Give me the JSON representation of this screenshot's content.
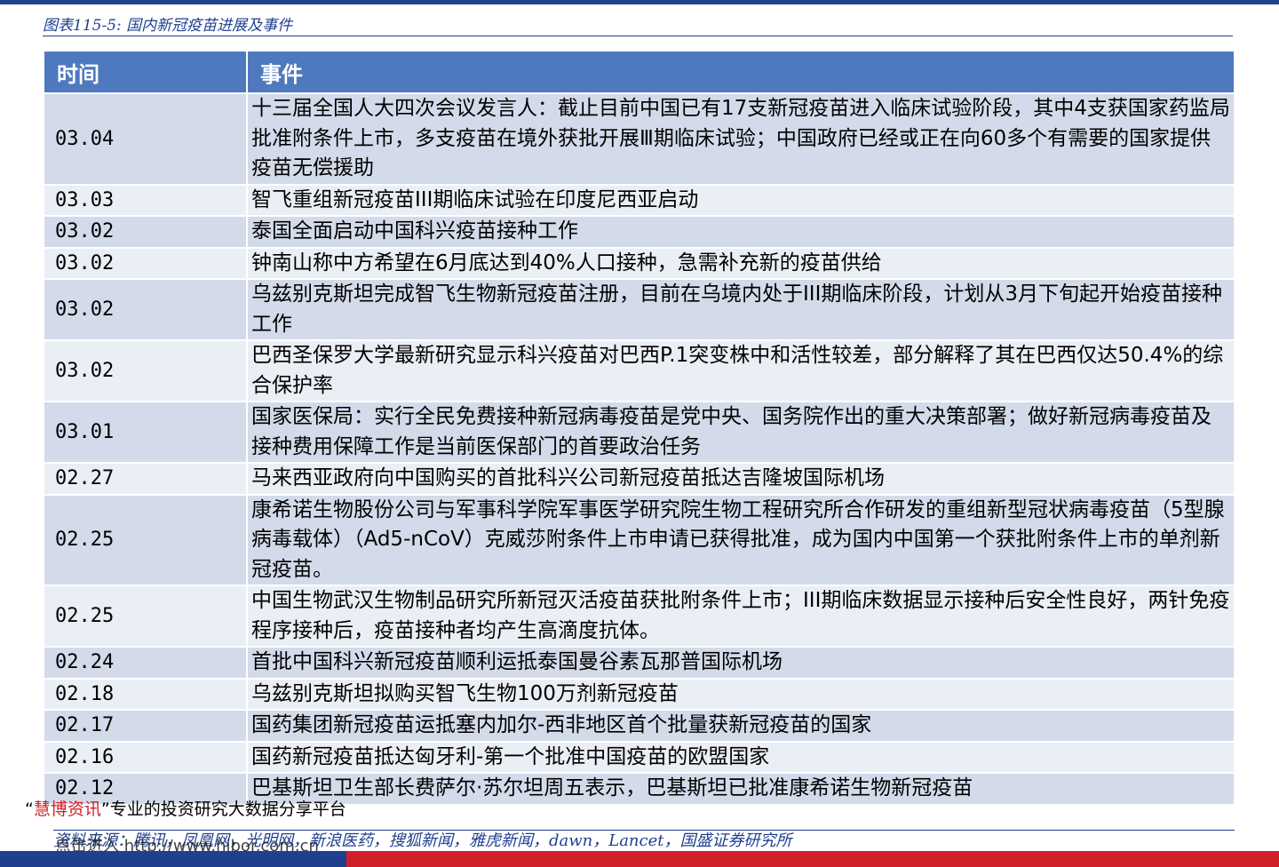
{
  "header": {
    "title": "图表115-5:  国内新冠疫苗进展及事件"
  },
  "table": {
    "columns": [
      "时间",
      "事件"
    ],
    "rows": [
      {
        "date": "03.04",
        "event": "十三届全国人大四次会议发言人：截止目前中国已有17支新冠疫苗进入临床试验阶段，其中4支获国家药监局批准附条件上市，多支疫苗在境外获批开展Ⅲ期临床试验；中国政府已经或正在向60多个有需要的国家提供疫苗无偿援助"
      },
      {
        "date": "03.03",
        "event": "智飞重组新冠疫苗III期临床试验在印度尼西亚启动"
      },
      {
        "date": "03.02",
        "event": "泰国全面启动中国科兴疫苗接种工作"
      },
      {
        "date": "03.02",
        "event": "钟南山称中方希望在6月底达到40%人口接种，急需补充新的疫苗供给"
      },
      {
        "date": "03.02",
        "event": "乌兹别克斯坦完成智飞生物新冠疫苗注册，目前在乌境内处于III期临床阶段，计划从3月下旬起开始疫苗接种工作"
      },
      {
        "date": "03.02",
        "event": "巴西圣保罗大学最新研究显示科兴疫苗对巴西P.1突变株中和活性较差，部分解释了其在巴西仅达50.4%的综合保护率"
      },
      {
        "date": "03.01",
        "event": "国家医保局：实行全民免费接种新冠病毒疫苗是党中央、国务院作出的重大决策部署；做好新冠病毒疫苗及接种费用保障工作是当前医保部门的首要政治任务"
      },
      {
        "date": "02.27",
        "event": "马来西亚政府向中国购买的首批科兴公司新冠疫苗抵达吉隆坡国际机场"
      },
      {
        "date": "02.25",
        "event": "康希诺生物股份公司与军事科学院军事医学研究院生物工程研究所合作研发的重组新型冠状病毒疫苗（5型腺病毒载体）（Ad5-nCoV）克威莎附条件上市申请已获得批准，成为国内中国第一个获批附条件上市的单剂新冠疫苗。"
      },
      {
        "date": "02.25",
        "event": "中国生物武汉生物制品研究所新冠灭活疫苗获批附条件上市；III期临床数据显示接种后安全性良好，两针免疫程序接种后，疫苗接种者均产生高滴度抗体。"
      },
      {
        "date": "02.24",
        "event": "首批中国科兴新冠疫苗顺利运抵泰国曼谷素瓦那普国际机场"
      },
      {
        "date": "02.18",
        "event": "乌兹别克斯坦拟购买智飞生物100万剂新冠疫苗"
      },
      {
        "date": "02.17",
        "event": "国药集团新冠疫苗运抵塞内加尔-西非地区首个批量获新冠疫苗的国家"
      },
      {
        "date": "02.16",
        "event": "国药新冠疫苗抵达匈牙利-第一个批准中国疫苗的欧盟国家"
      },
      {
        "date": "02.12",
        "event": "巴基斯坦卫生部长费萨尔·苏尔坦周五表示，巴基斯坦已批准康希诺生物新冠疫苗"
      }
    ]
  },
  "footer": {
    "brand_open": "“",
    "brand_name": "慧博资讯",
    "brand_close": "”",
    "tagline": "专业的投资研究大数据分享平台",
    "source": "资料来源：腾讯，凤凰网，光明网，新浪医药，搜狐新闻，雅虎新闻，dawn，Lancet，国盛证券研究所",
    "watermark": "点击进入 http://www.hibor.com.cn"
  },
  "colors": {
    "header_bg": "#4f79bf",
    "row_odd": "#d3dbea",
    "row_even": "#eaeef5",
    "brand_red": "#d0202a",
    "navy": "#1f3f8f"
  }
}
